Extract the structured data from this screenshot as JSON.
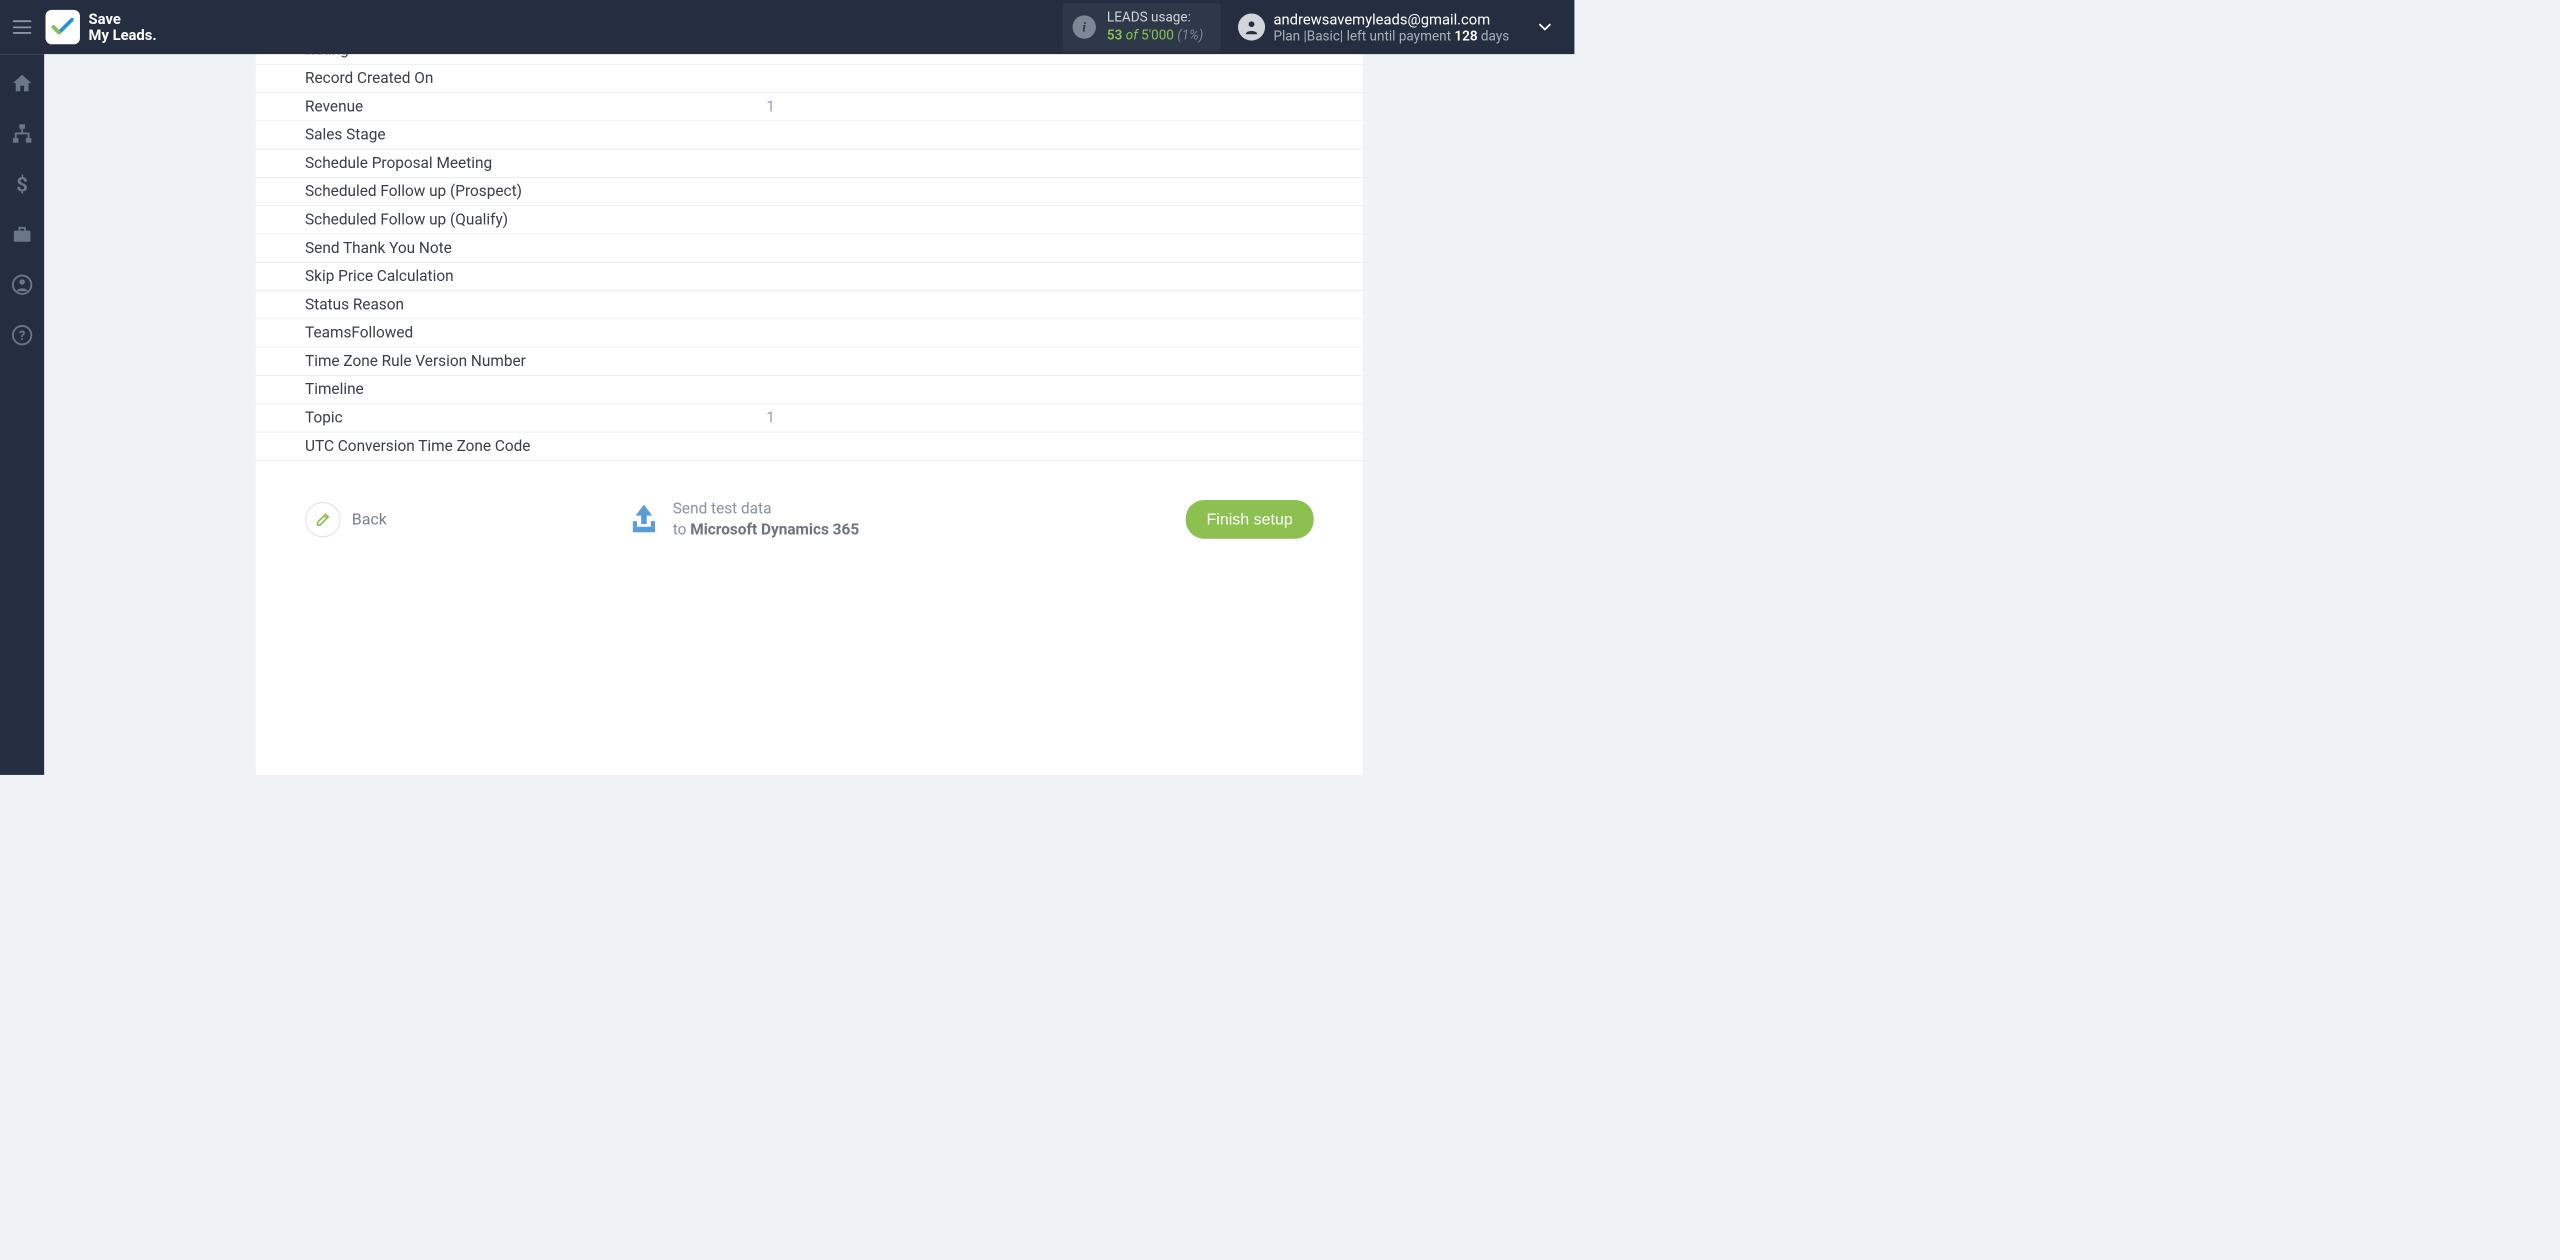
{
  "brand": {
    "line1": "Save",
    "line2": "My Leads."
  },
  "usage": {
    "label": "LEADS usage:",
    "current": "53",
    "of_word": "of",
    "total": "5'000",
    "percent": "(1%)"
  },
  "account": {
    "email": "andrewsavemyleads@gmail.com",
    "plan_prefix": "Plan |",
    "plan_name": "Basic",
    "plan_mid": "| left until payment ",
    "days_num": "128",
    "days_word": " days"
  },
  "fields": [
    {
      "label": "Rating",
      "value": ""
    },
    {
      "label": "Record Created On",
      "value": ""
    },
    {
      "label": "Revenue",
      "value": "1"
    },
    {
      "label": "Sales Stage",
      "value": ""
    },
    {
      "label": "Schedule Proposal Meeting",
      "value": ""
    },
    {
      "label": "Scheduled Follow up (Prospect)",
      "value": ""
    },
    {
      "label": "Scheduled Follow up (Qualify)",
      "value": ""
    },
    {
      "label": "Send Thank You Note",
      "value": ""
    },
    {
      "label": "Skip Price Calculation",
      "value": ""
    },
    {
      "label": "Status Reason",
      "value": ""
    },
    {
      "label": "TeamsFollowed",
      "value": ""
    },
    {
      "label": "Time Zone Rule Version Number",
      "value": ""
    },
    {
      "label": "Timeline",
      "value": ""
    },
    {
      "label": "Topic",
      "value": "1"
    },
    {
      "label": "UTC Conversion Time Zone Code",
      "value": ""
    }
  ],
  "actions": {
    "back_label": "Back",
    "send_line1": "Send test data",
    "send_to_word": "to ",
    "send_destination": "Microsoft Dynamics 365",
    "finish_label": "Finish setup"
  }
}
